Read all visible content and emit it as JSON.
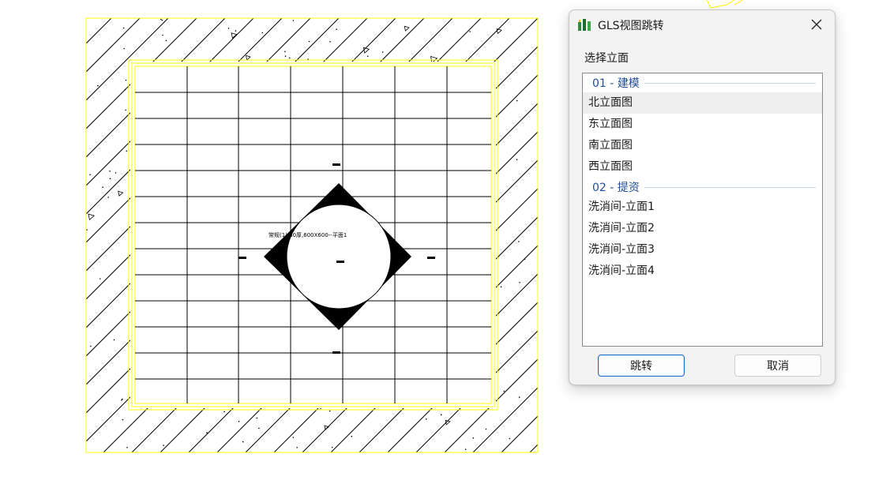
{
  "drawing": {
    "annotation": "常规(1),S0厚,600X600--平面1",
    "colors": {
      "boundary": "#ffff00",
      "lines": "#000000",
      "background": "#ffffff"
    }
  },
  "dialog": {
    "title": "GLS视图跳转",
    "icon": "gls-app-icon",
    "close_icon": "close-icon",
    "section_label": "选择立面",
    "groups": [
      {
        "header": "01 - 建模",
        "items": [
          "北立面图",
          "东立面图",
          "南立面图",
          "西立面图"
        ]
      },
      {
        "header": "02 - 提资",
        "items": [
          "洗消间-立面1",
          "洗消间-立面2",
          "洗消间-立面3",
          "洗消间-立面4"
        ]
      }
    ],
    "hovered_item": "北立面图",
    "confirm_label": "跳转",
    "cancel_label": "取消",
    "accent_color": "#1f4e9c",
    "highlight_color": "#e0282e"
  }
}
